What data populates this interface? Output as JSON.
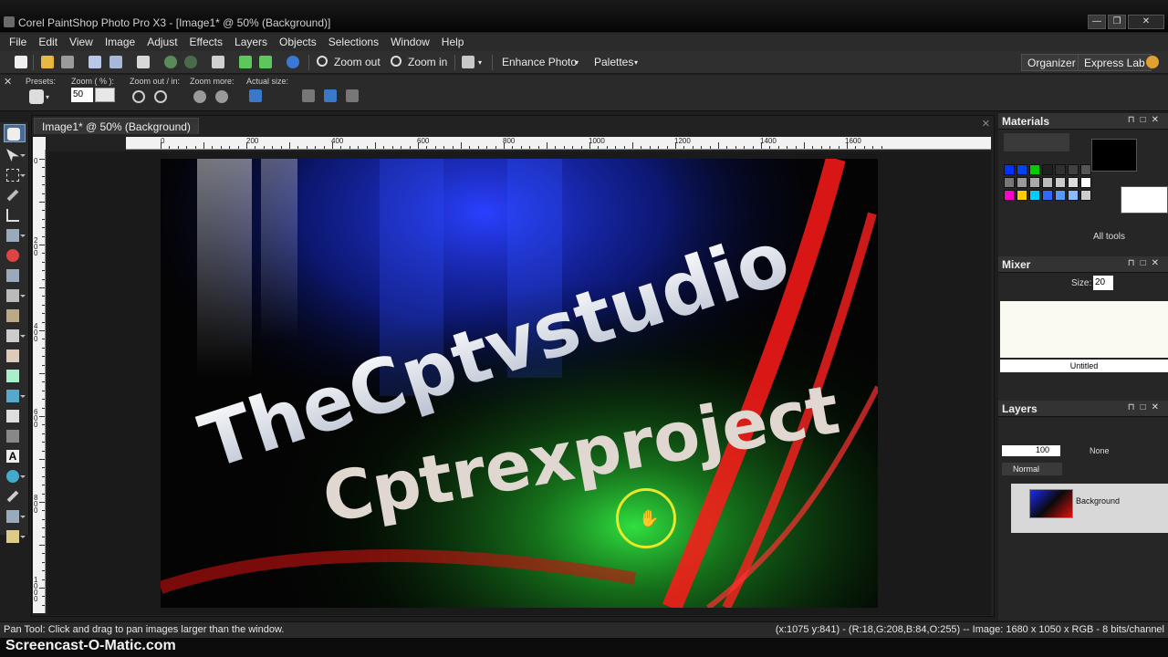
{
  "window": {
    "title": "Corel PaintShop Photo Pro X3 - [Image1* @  50% (Background)]",
    "min": "—",
    "max": "❐",
    "close": "✕"
  },
  "menubar": [
    "File",
    "Edit",
    "View",
    "Image",
    "Adjust",
    "Effects",
    "Layers",
    "Objects",
    "Selections",
    "Window",
    "Help"
  ],
  "toolbar": {
    "zoom_out": "Zoom out",
    "zoom_in": "Zoom in",
    "enhance_photo": "Enhance Photo",
    "palettes": "Palettes",
    "organizer": "Organizer",
    "express_lab": "Express Lab"
  },
  "optbar": {
    "presets": "Presets:",
    "zoom_pct": "Zoom ( % ):",
    "zoom_value": "50",
    "zoom_out_in": "Zoom out / in:",
    "zoom_more": "Zoom more:",
    "actual_size": "Actual size:"
  },
  "document": {
    "tab": "Image1* @  50% (Background)",
    "close": "✕",
    "ruler_h": [
      "0",
      "200",
      "400",
      "600",
      "800",
      "1000",
      "1200",
      "1400",
      "1600"
    ],
    "ruler_v": [
      "0",
      "2 0 0",
      "4 0 0",
      "6 0 0",
      "8 0 0",
      "1 0 0 0"
    ]
  },
  "image_text": {
    "line1": "TheCptvstudio",
    "line2": "Cptrexproject"
  },
  "materials": {
    "title": "Materials",
    "all_tools": "All tools",
    "colors": {
      "row1": [
        "#0033ff",
        "#0044ee",
        "#00cc00",
        "#202020",
        "#303030",
        "#404040",
        "#555555"
      ],
      "row2": [
        "#777777",
        "#999999",
        "#aaaaaa",
        "#bbbbbb",
        "#cccccc",
        "#dddddd",
        "#ffffff"
      ],
      "row3": [
        "#ff00cc",
        "#ffcc00",
        "#00ccff",
        "#3366ff",
        "#5599ff",
        "#88bbff",
        "#cccccc"
      ]
    }
  },
  "mixer": {
    "title": "Mixer",
    "size_label": "Size:",
    "size_value": "20",
    "untitled": "Untitled"
  },
  "layers": {
    "title": "Layers",
    "opacity": "100",
    "mask": "None",
    "blend": "Normal",
    "layer_name": "Background"
  },
  "statusbar": {
    "left": "Pan Tool: Click and drag to pan images larger than the window.",
    "right": "(x:1075 y:841) - (R:18,G:208,B:84,O:255) -- Image:  1680 x 1050 x RGB - 8 bits/channel"
  },
  "watermark": "Screencast-O-Matic.com"
}
